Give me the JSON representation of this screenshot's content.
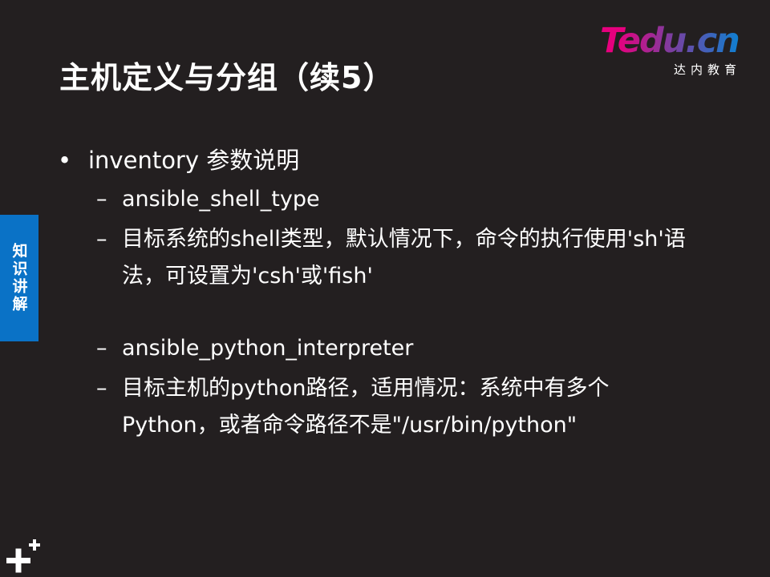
{
  "slide": {
    "title": "主机定义与分组（续5）",
    "side_tab": "知识讲解",
    "logo": {
      "brand_t": "T",
      "brand_rest": "edu.cn",
      "subtitle": "达内教育"
    },
    "bullet": {
      "marker": "•",
      "text": "inventory 参数说明"
    },
    "dash_marker": "–",
    "items": [
      {
        "text": "ansible_shell_type"
      },
      {
        "text": "目标系统的shell类型，默认情况下，命令的执行使用'sh'语法，可设置为'csh'或'fish'"
      },
      {
        "text": "ansible_python_interpreter"
      },
      {
        "text": "目标主机的python路径，适用情况：系统中有多个Python，或者命令路径不是\"/usr/bin/python\""
      }
    ]
  }
}
